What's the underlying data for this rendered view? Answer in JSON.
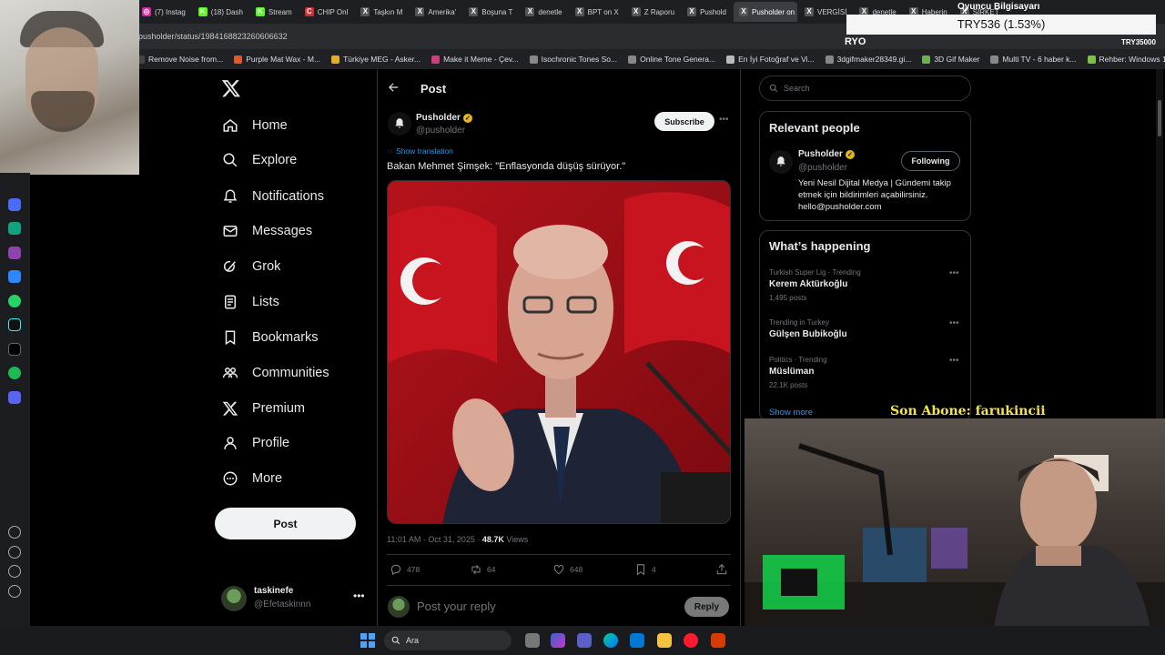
{
  "browser": {
    "tabs": [
      {
        "label": "(7) Instag",
        "color": "#d6249f",
        "glyph": "◎"
      },
      {
        "label": "(18) Dash",
        "color": "#53fc18",
        "glyph": "K"
      },
      {
        "label": "Stream",
        "color": "#53fc18",
        "glyph": "K"
      },
      {
        "label": "CHIP Onl",
        "color": "#d32f2f",
        "glyph": "C"
      },
      {
        "label": "Taşkın M",
        "color": "#555",
        "glyph": "X"
      },
      {
        "label": "Amerika'",
        "color": "#555",
        "glyph": "X"
      },
      {
        "label": "Boşuna T",
        "color": "#555",
        "glyph": "X"
      },
      {
        "label": "denetle",
        "color": "#555",
        "glyph": "X"
      },
      {
        "label": "BPT on X",
        "color": "#555",
        "glyph": "X"
      },
      {
        "label": "Z Raporu",
        "color": "#555",
        "glyph": "X"
      },
      {
        "label": "Pushold",
        "color": "#555",
        "glyph": "X"
      },
      {
        "label": "Pusholder on X",
        "color": "#555",
        "glyph": "X",
        "active": true
      },
      {
        "label": "VERGİSİ",
        "color": "#555",
        "glyph": "X"
      },
      {
        "label": "denetle",
        "color": "#555",
        "glyph": "X"
      },
      {
        "label": "Haberin",
        "color": "#555",
        "glyph": "X"
      },
      {
        "label": "ŞİRKET",
        "color": "#555",
        "glyph": "X"
      }
    ],
    "url": "pusholder/status/1984168823260606632",
    "bookmarks": [
      {
        "label": "Remove Noise from...",
        "color": "#444"
      },
      {
        "label": "Purple Mat Wax - M...",
        "color": "#e4572e"
      },
      {
        "label": "Türkiye MEG - Asker...",
        "color": "#e0b020"
      },
      {
        "label": "Make it Meme - Çev...",
        "color": "#d13b7c"
      },
      {
        "label": "Isochronic Tones So...",
        "color": "#888"
      },
      {
        "label": "Online Tone Genera...",
        "color": "#888"
      },
      {
        "label": "En İyi Fotoğraf ve Vi...",
        "color": "#bbb"
      },
      {
        "label": "3dgifmaker28349.gi...",
        "color": "#888"
      },
      {
        "label": "3D Gif Maker",
        "color": "#6ab04c"
      },
      {
        "label": "Multi TV - 6 haber k...",
        "color": "#888"
      },
      {
        "label": "Rehber: Windows 1...",
        "color": "#7cc242"
      }
    ]
  },
  "overlay": {
    "ticker_title": "Oyuncu Bilgisayarı",
    "ticker": "TRY536 (1.53%)",
    "ryo": "RYO",
    "try_small": "TRY35000",
    "sub_label": "Son Abone: farukincii"
  },
  "nav": {
    "items": [
      {
        "label": "Home",
        "icon": "home-icon"
      },
      {
        "label": "Explore",
        "icon": "search-icon"
      },
      {
        "label": "Notifications",
        "icon": "bell-icon"
      },
      {
        "label": "Messages",
        "icon": "mail-icon"
      },
      {
        "label": "Grok",
        "icon": "grok-icon"
      },
      {
        "label": "Lists",
        "icon": "list-icon"
      },
      {
        "label": "Bookmarks",
        "icon": "bookmark-icon"
      },
      {
        "label": "Communities",
        "icon": "communities-icon"
      },
      {
        "label": "Premium",
        "icon": "x-icon"
      },
      {
        "label": "Profile",
        "icon": "person-icon"
      },
      {
        "label": "More",
        "icon": "more-circle-icon"
      }
    ],
    "post_label": "Post",
    "account": {
      "name": "taskinefe",
      "handle": "@Efetaskinnn"
    }
  },
  "post": {
    "heading": "Post",
    "author": {
      "name": "Pusholder",
      "handle": "@pusholder"
    },
    "subscribe_label": "Subscribe",
    "show_translation": "Show translation",
    "text": "Bakan Mehmet Şimşek: \"Enflasyonda düşüş sürüyor.\"",
    "time": "11:01 AM · Oct 31, 2025 · ",
    "views_count": "48.7K",
    "views_label": " Views",
    "stats": {
      "replies": "478",
      "reposts": "64",
      "likes": "648",
      "bookmarks": "4"
    },
    "reply_placeholder": "Post your reply",
    "reply_label": "Reply"
  },
  "sidebar": {
    "search_placeholder": "Search",
    "relevant": {
      "title": "Relevant people",
      "name": "Pusholder",
      "handle": "@pusholder",
      "follow_label": "Following",
      "bio": "Yeni Nesil Dijital Medya | Gündemi takip etmek için bildirimleri açabilirsiniz. hello@pusholder.com"
    },
    "happening": {
      "title": "What’s happening",
      "trends": [
        {
          "context": "Turkish Super Lig · Trending",
          "name": "Kerem Aktürkoğlu",
          "count": "1,495 posts"
        },
        {
          "context": "Trending in Turkey",
          "name": "Gülşen Bubikoğlu",
          "count": ""
        },
        {
          "context": "Politics · Trending",
          "name": "Müslüman",
          "count": "22.1K posts"
        }
      ],
      "show_more": "Show more"
    }
  },
  "taskbar": {
    "search_label": "Ara"
  }
}
